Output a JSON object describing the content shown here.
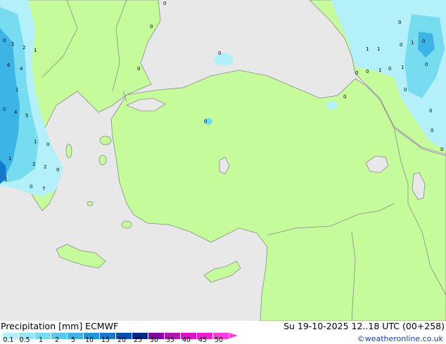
{
  "footer": {
    "title": "Precipitation [mm]  ECMWF",
    "datetime": "Su 19-10-2025 12..18 UTC (00+258)",
    "credit": "©weatheronline.co.uk"
  },
  "legend": {
    "ticks": [
      "0.1",
      "0.5",
      "1",
      "2",
      "5",
      "10",
      "15",
      "20",
      "25",
      "30",
      "35",
      "40",
      "45",
      "50"
    ],
    "colors": [
      "#b4f0fa",
      "#96e6f5",
      "#78dcf0",
      "#5ac8eb",
      "#3cb4e6",
      "#1e96dc",
      "#1478cd",
      "#0a50b4",
      "#00288c",
      "#820aa0",
      "#b414b4",
      "#dc14c8",
      "#f01ed2",
      "#fa3cdc"
    ]
  },
  "map": {
    "land_color": "#c6fb9c",
    "sea_color": "#e8e8e8",
    "border_color": "#8a8a8a",
    "precip_labels": [
      "0",
      "1",
      "2",
      "4",
      "5",
      "6",
      "7"
    ]
  }
}
